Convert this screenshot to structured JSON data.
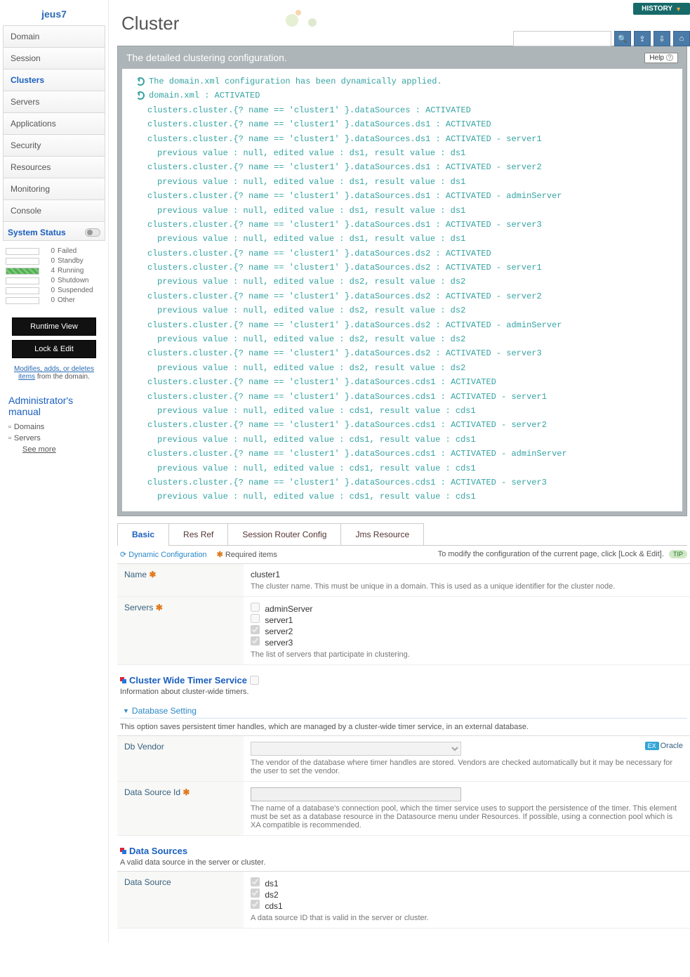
{
  "brand": "jeus7",
  "nav": [
    "Domain",
    "Session",
    "Clusters",
    "Servers",
    "Applications",
    "Security",
    "Resources",
    "Monitoring",
    "Console"
  ],
  "nav_active_index": 2,
  "system_status": {
    "title": "System Status",
    "items": [
      {
        "count": 0,
        "label": "Failed"
      },
      {
        "count": 0,
        "label": "Standby"
      },
      {
        "count": 4,
        "label": "Running",
        "running": true
      },
      {
        "count": 0,
        "label": "Shutdown"
      },
      {
        "count": 0,
        "label": "Suspended"
      },
      {
        "count": 0,
        "label": "Other"
      }
    ]
  },
  "buttons": {
    "runtime": "Runtime View",
    "lock": "Lock & Edit"
  },
  "side_note": {
    "link": "Modifies, adds, or deletes items",
    "rest": " from the domain."
  },
  "admin": {
    "title": "Administrator's manual",
    "links": [
      "Domains",
      "Servers"
    ],
    "see_more": "See more"
  },
  "history_label": "HISTORY",
  "page_title": "Cluster",
  "detail_title": "The detailed clustering configuration.",
  "help_label": "Help",
  "log_lines": [
    {
      "icon": true,
      "cls": "",
      "text": "The domain.xml configuration has been dynamically applied."
    },
    {
      "icon": true,
      "cls": "",
      "text": "domain.xml : ACTIVATED"
    },
    {
      "cls": "indent1",
      "text": "clusters.cluster.{? name == 'cluster1' }.dataSources : ACTIVATED"
    },
    {
      "cls": "indent1",
      "text": "clusters.cluster.{? name == 'cluster1' }.dataSources.ds1 : ACTIVATED"
    },
    {
      "cls": "indent1",
      "text": "clusters.cluster.{? name == 'cluster1' }.dataSources.ds1 : ACTIVATED - server1"
    },
    {
      "cls": "indent2",
      "text": "previous value : null, edited value : ds1, result value : ds1"
    },
    {
      "cls": "indent1",
      "text": "clusters.cluster.{? name == 'cluster1' }.dataSources.ds1 : ACTIVATED - server2"
    },
    {
      "cls": "indent2",
      "text": "previous value : null, edited value : ds1, result value : ds1"
    },
    {
      "cls": "indent1",
      "text": "clusters.cluster.{? name == 'cluster1' }.dataSources.ds1 : ACTIVATED - adminServer"
    },
    {
      "cls": "indent2",
      "text": "previous value : null, edited value : ds1, result value : ds1"
    },
    {
      "cls": "indent1",
      "text": "clusters.cluster.{? name == 'cluster1' }.dataSources.ds1 : ACTIVATED - server3"
    },
    {
      "cls": "indent2",
      "text": "previous value : null, edited value : ds1, result value : ds1"
    },
    {
      "cls": "indent1",
      "text": "clusters.cluster.{? name == 'cluster1' }.dataSources.ds2 : ACTIVATED"
    },
    {
      "cls": "indent1",
      "text": "clusters.cluster.{? name == 'cluster1' }.dataSources.ds2 : ACTIVATED - server1"
    },
    {
      "cls": "indent2",
      "text": "previous value : null, edited value : ds2, result value : ds2"
    },
    {
      "cls": "indent1",
      "text": "clusters.cluster.{? name == 'cluster1' }.dataSources.ds2 : ACTIVATED - server2"
    },
    {
      "cls": "indent2",
      "text": "previous value : null, edited value : ds2, result value : ds2"
    },
    {
      "cls": "indent1",
      "text": "clusters.cluster.{? name == 'cluster1' }.dataSources.ds2 : ACTIVATED - adminServer"
    },
    {
      "cls": "indent2",
      "text": "previous value : null, edited value : ds2, result value : ds2"
    },
    {
      "cls": "indent1",
      "text": "clusters.cluster.{? name == 'cluster1' }.dataSources.ds2 : ACTIVATED - server3"
    },
    {
      "cls": "indent2",
      "text": "previous value : null, edited value : ds2, result value : ds2"
    },
    {
      "cls": "indent1",
      "text": "clusters.cluster.{? name == 'cluster1' }.dataSources.cds1 : ACTIVATED"
    },
    {
      "cls": "indent1",
      "text": "clusters.cluster.{? name == 'cluster1' }.dataSources.cds1 : ACTIVATED - server1"
    },
    {
      "cls": "indent2",
      "text": "previous value : null, edited value : cds1, result value : cds1"
    },
    {
      "cls": "indent1",
      "text": "clusters.cluster.{? name == 'cluster1' }.dataSources.cds1 : ACTIVATED - server2"
    },
    {
      "cls": "indent2",
      "text": "previous value : null, edited value : cds1, result value : cds1"
    },
    {
      "cls": "indent1",
      "text": "clusters.cluster.{? name == 'cluster1' }.dataSources.cds1 : ACTIVATED - adminServer"
    },
    {
      "cls": "indent2",
      "text": "previous value : null, edited value : cds1, result value : cds1"
    },
    {
      "cls": "indent1",
      "text": "clusters.cluster.{? name == 'cluster1' }.dataSources.cds1 : ACTIVATED - server3"
    },
    {
      "cls": "indent2",
      "text": "previous value : null, edited value : cds1, result value : cds1"
    }
  ],
  "tabs": [
    "Basic",
    "Res Ref",
    "Session Router Config",
    "Jms Resource"
  ],
  "tabs_active_index": 0,
  "infobar": {
    "dyn": "Dynamic Configuration",
    "req": "Required items",
    "tip_text": "To modify the configuration of the current page, click [Lock & Edit].",
    "tip": "TIP"
  },
  "form": {
    "name": {
      "label": "Name",
      "value": "cluster1",
      "desc": "The cluster name. This must be unique in a domain. This is used as a unique identifier for the cluster node."
    },
    "servers": {
      "label": "Servers",
      "options": [
        {
          "label": "adminServer",
          "checked": false
        },
        {
          "label": "server1",
          "checked": false
        },
        {
          "label": "server2",
          "checked": true
        },
        {
          "label": "server3",
          "checked": true
        }
      ],
      "desc": "The list of servers that participate in clustering."
    }
  },
  "timer": {
    "title": "Cluster Wide Timer Service",
    "desc": "Information about cluster-wide timers."
  },
  "db": {
    "title": "Database Setting",
    "desc": "This option saves persistent timer handles, which are managed by a cluster-wide timer service, in an external database.",
    "vendor": {
      "label": "Db Vendor",
      "example": "Oracle",
      "desc": "The vendor of the database where timer handles are stored. Vendors are checked automatically but it may be necessary for the user to set the vendor."
    },
    "dsid": {
      "label": "Data Source Id",
      "desc": "The name of a database's connection pool, which the timer service uses to support the persistence of the timer. This element must be set as a database resource in the Datasource menu under Resources. If possible, using a connection pool which is XA compatible is recommended."
    }
  },
  "ds": {
    "title": "Data Sources",
    "desc": "A valid data source in the server or cluster.",
    "label": "Data Source",
    "options": [
      {
        "label": "ds1",
        "checked": true
      },
      {
        "label": "ds2",
        "checked": true
      },
      {
        "label": "cds1",
        "checked": true
      }
    ],
    "item_desc": "A data source ID that is valid in the server or cluster."
  },
  "ex_badge": "EX"
}
